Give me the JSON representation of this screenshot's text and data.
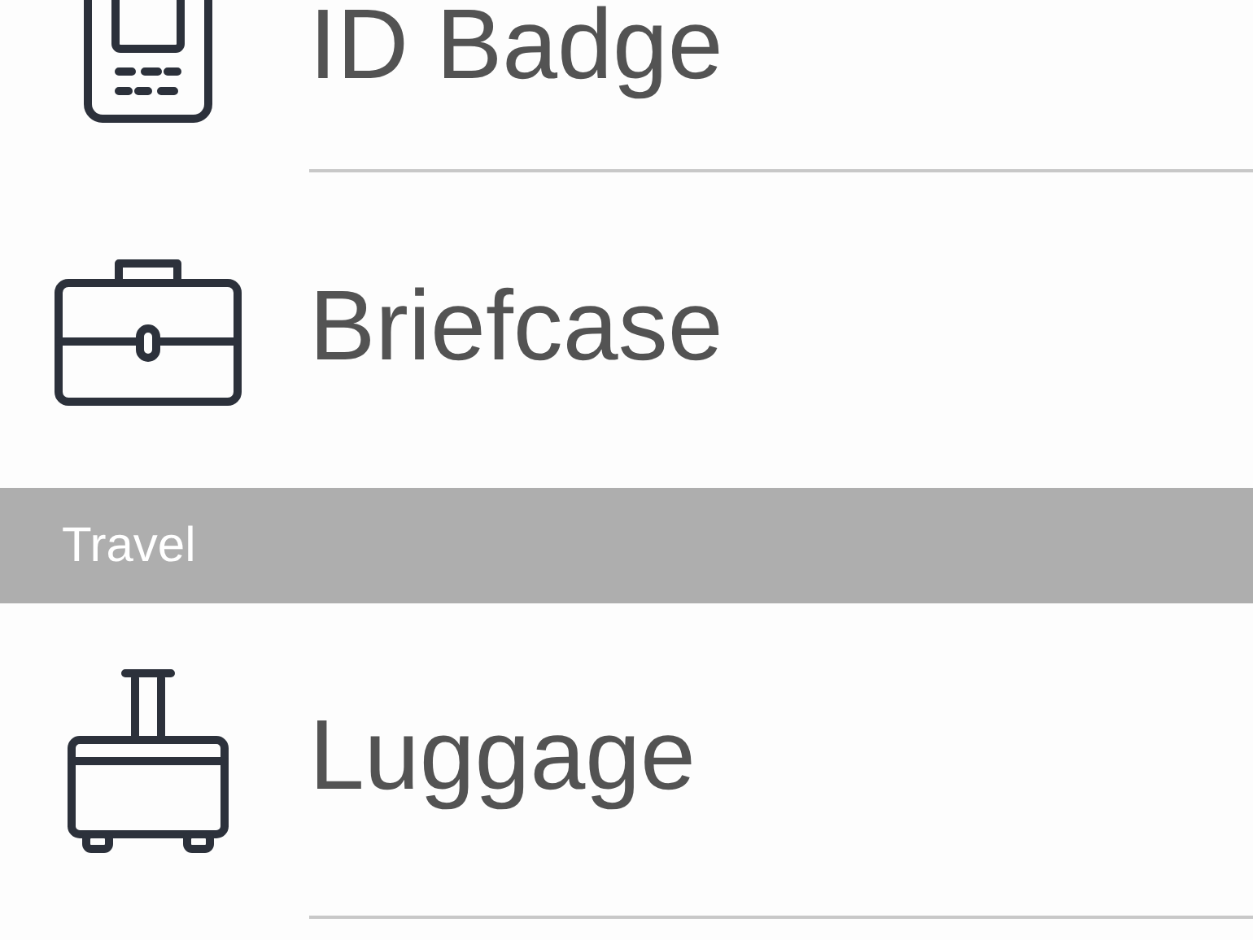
{
  "sections": [
    {
      "items": [
        {
          "kind": "id-badge",
          "label": "ID Badge"
        },
        {
          "kind": "briefcase",
          "label": "Briefcase"
        }
      ]
    },
    {
      "title": "Travel",
      "items": [
        {
          "kind": "luggage",
          "label": "Luggage"
        }
      ]
    }
  ]
}
